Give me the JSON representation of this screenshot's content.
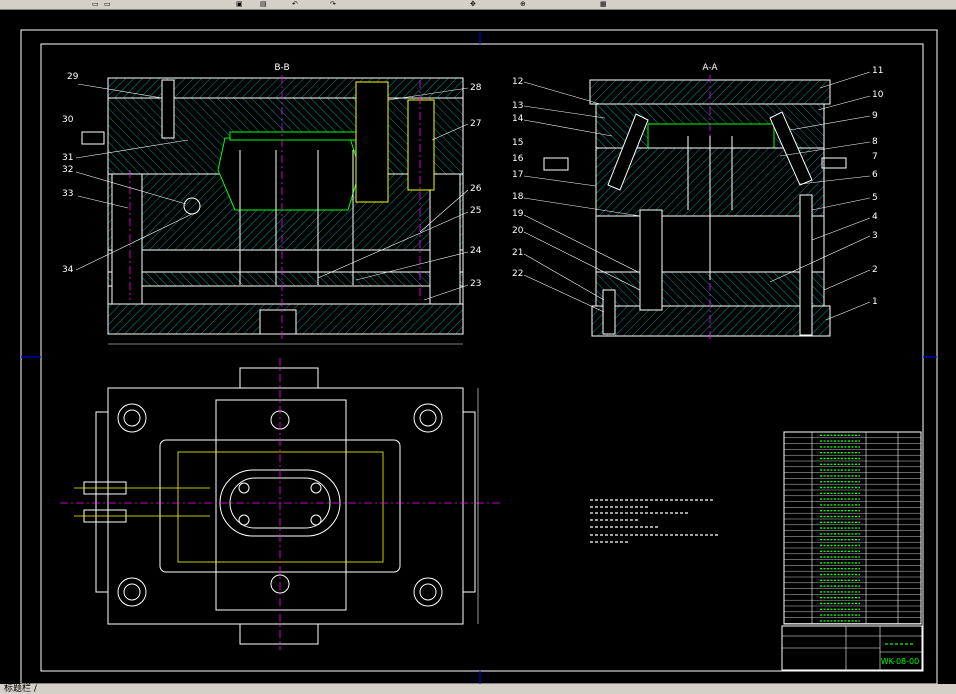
{
  "toolbar": {
    "icons": [
      "new-icon",
      "open-icon",
      "save-icon",
      "print-icon",
      "undo-icon",
      "redo-icon",
      "pan-icon",
      "zoom-icon",
      "properties-icon"
    ]
  },
  "status": {
    "text": "标题栏 /"
  },
  "drawing": {
    "view_bb": "B-B",
    "view_aa": "A-A",
    "left_labels": [
      "29",
      "30",
      "31",
      "32",
      "33",
      "34"
    ],
    "mid_labels": [
      "28",
      "27",
      "26",
      "25",
      "24",
      "23"
    ],
    "aa_left_labels": [
      "12",
      "13",
      "14",
      "15",
      "16",
      "17",
      "18",
      "19",
      "20",
      "21",
      "22"
    ],
    "aa_right_labels": [
      "11",
      "10",
      "9",
      "8",
      "7",
      "6",
      "5",
      "4",
      "3",
      "2",
      "1"
    ],
    "title_code": "WK-08-00",
    "colors": {
      "outline": "#ffffff",
      "hatch": "#00ffff",
      "yellow": "#ffff00",
      "green": "#00ff00",
      "magenta": "#ff00ff",
      "red": "#ff0000",
      "blue": "#0000ff"
    }
  }
}
